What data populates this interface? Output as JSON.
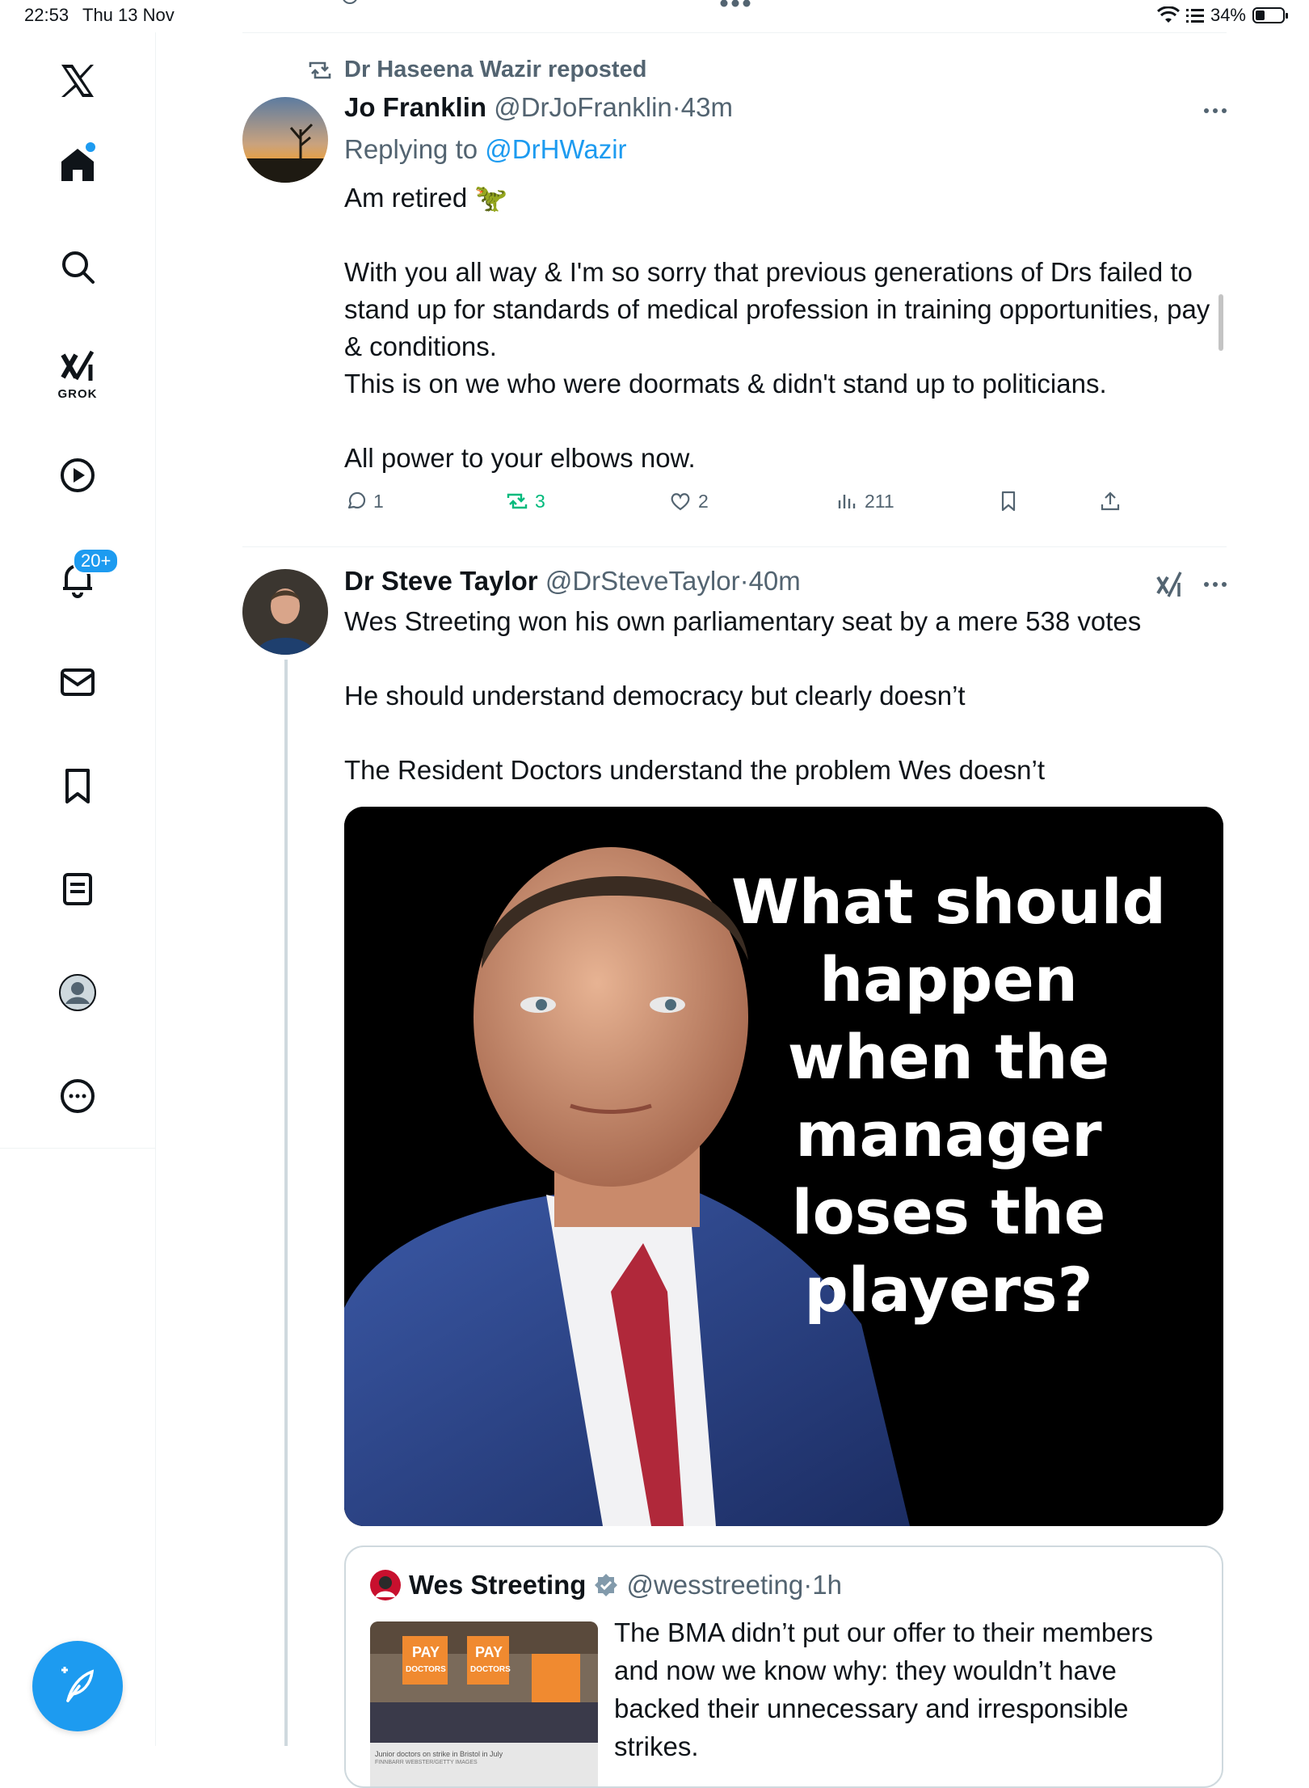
{
  "status_bar": {
    "time": "22:53",
    "date": "Thu 13 Nov",
    "battery": "34%",
    "battery_level": 0.34
  },
  "sidebar": {
    "grok_label": "GROK",
    "notifications_badge": "20+"
  },
  "feed": {
    "tweets": [
      {
        "repost_label": "Dr Haseena Wazir reposted",
        "name": "Jo Franklin",
        "handle": "@DrJoFranklin",
        "time": "43m",
        "replying_prefix": "Replying to",
        "replying_handle": "@DrHWazir",
        "text": [
          "Am retired 🦖",
          "With you all way & I'm so sorry that previous generations of Drs failed to stand up for standards of medical profession in training opportunities, pay & conditions.",
          "This is on we who were doormats & didn't stand up to politicians.",
          "All power to your elbows now."
        ],
        "stats": {
          "replies": "1",
          "reposts": "3",
          "likes": "2",
          "views": "211"
        }
      },
      {
        "name": "Dr Steve Taylor",
        "handle": "@DrSteveTaylor",
        "time": "40m",
        "text": [
          "Wes Streeting won his own parliamentary seat by a mere 538 votes",
          "He should understand democracy but clearly doesn’t",
          "The Resident Doctors understand the problem Wes doesn’t"
        ],
        "media_caption": [
          "What should",
          "happen",
          "when the",
          "manager",
          "loses the",
          "players?"
        ],
        "quote": {
          "name": "Wes Streeting",
          "handle": "@wesstreeting",
          "time": "1h",
          "text": "The BMA didn’t put our offer to their members and now we know why: they wouldn’t have backed their unnecessary and irresponsible strikes.",
          "thumb_caption": "Junior doctors on strike in Bristol in July",
          "thumb_credit": "FINNBARR WEBSTER/GETTY IMAGES",
          "thumb_signs": [
            "PAY",
            "DOCTORS"
          ]
        }
      }
    ]
  },
  "colors": {
    "accent": "#1d9bf0",
    "repost_green": "#00ba7c",
    "muted": "#536471"
  }
}
